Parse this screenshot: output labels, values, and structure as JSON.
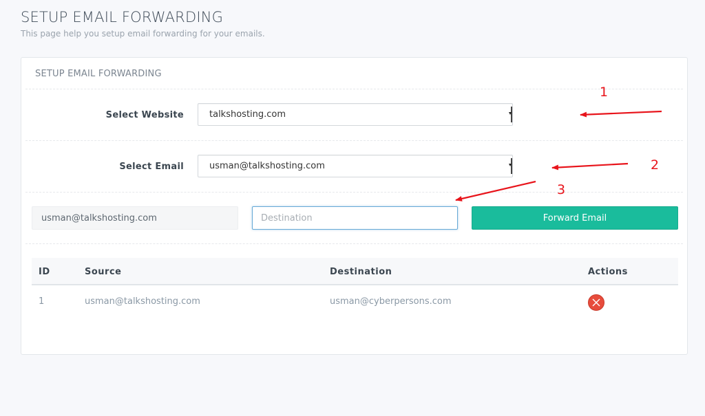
{
  "header": {
    "title": "SETUP EMAIL FORWARDING",
    "subtitle": "This page help you setup email forwarding for your emails."
  },
  "card": {
    "title": "SETUP EMAIL FORWARDING",
    "website_label": "Select Website",
    "website_selected": "talkshosting.com",
    "email_label": "Select Email",
    "email_selected": "usman@talkshosting.com",
    "source_value": "usman@talkshosting.com",
    "destination_placeholder": "Destination",
    "forward_button": "Forward Email"
  },
  "table": {
    "columns": [
      "ID",
      "Source",
      "Destination",
      "Actions"
    ],
    "rows": [
      {
        "id": "1",
        "source": "usman@talkshosting.com",
        "destination": "usman@cyberpersons.com",
        "action": "delete-icon"
      }
    ]
  },
  "annotations": {
    "labels": [
      "1",
      "2",
      "3"
    ],
    "color": "#e8141b"
  },
  "colors": {
    "accent": "#1abc9c",
    "danger": "#e74c3c",
    "focus": "#66a9d6"
  }
}
